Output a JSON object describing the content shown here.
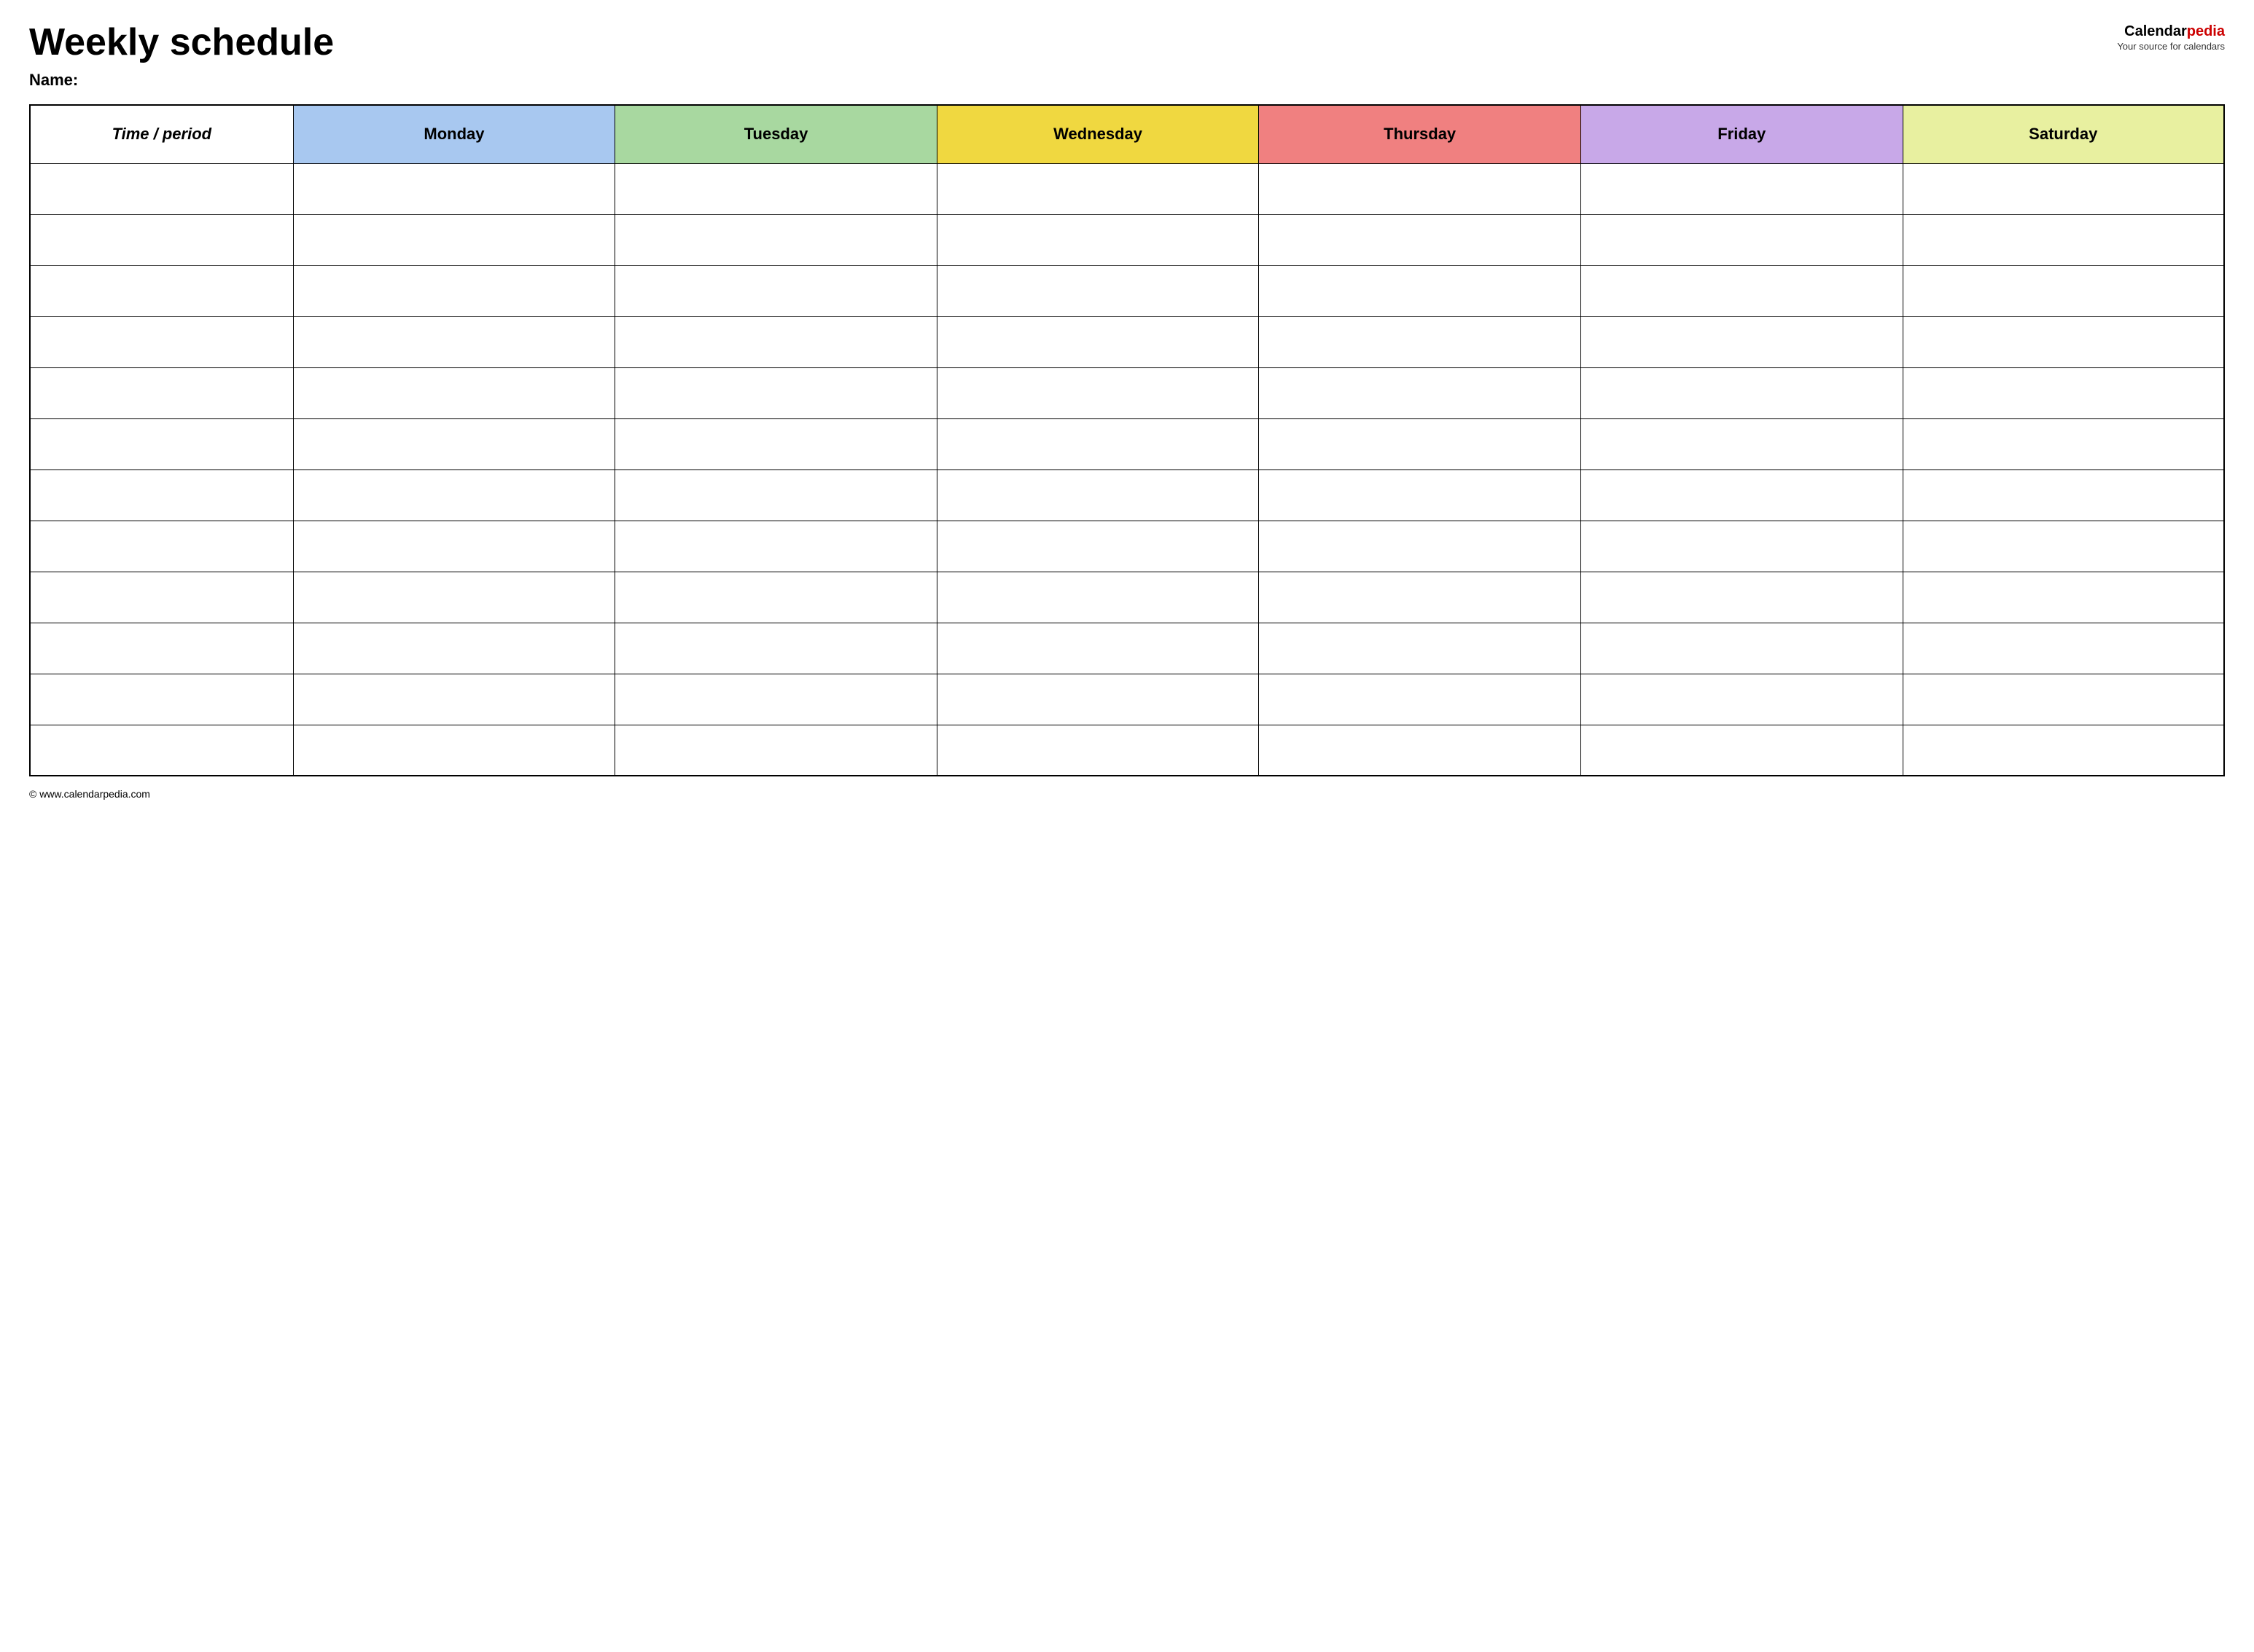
{
  "header": {
    "title": "Weekly schedule",
    "name_label": "Name:",
    "logo_calendar": "Calendar",
    "logo_pedia": "pedia",
    "logo_tagline": "Your source for calendars"
  },
  "table": {
    "columns": [
      {
        "id": "time",
        "label": "Time / period",
        "color": "#ffffff"
      },
      {
        "id": "monday",
        "label": "Monday",
        "color": "#a8c8f0"
      },
      {
        "id": "tuesday",
        "label": "Tuesday",
        "color": "#a8d8a0"
      },
      {
        "id": "wednesday",
        "label": "Wednesday",
        "color": "#f0d840"
      },
      {
        "id": "thursday",
        "label": "Thursday",
        "color": "#f08080"
      },
      {
        "id": "friday",
        "label": "Friday",
        "color": "#c8a8e8"
      },
      {
        "id": "saturday",
        "label": "Saturday",
        "color": "#e8f0a0"
      }
    ],
    "row_count": 12
  },
  "footer": {
    "url": "© www.calendarpedia.com"
  }
}
